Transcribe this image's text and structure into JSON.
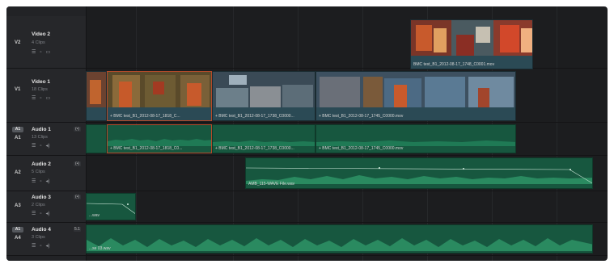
{
  "tracks": [
    {
      "id": "V2",
      "name": "Video 2",
      "clips": "4 Clips"
    },
    {
      "id": "V1",
      "name": "Video 1",
      "clips": "18 Clips"
    },
    {
      "id": "A1",
      "name": "Audio 1",
      "clips": "13 Clips",
      "chip": "A1",
      "mode": "(•)"
    },
    {
      "id": "A2",
      "name": "Audio 2",
      "clips": "5 Clips",
      "mode": "(•)"
    },
    {
      "id": "A3",
      "name": "Audio 3",
      "clips": "2 Clips",
      "mode": "(•)"
    },
    {
      "id": "A4",
      "name": "Audio 4",
      "clips": "3 Clips",
      "chip": "A1",
      "mode": "5.1"
    }
  ],
  "icons": {
    "video": [
      "toggle-icon",
      "lock-icon",
      "monitor-icon"
    ],
    "audio": [
      "toggle-icon",
      "lock-icon",
      "speaker-icon"
    ]
  },
  "clips": {
    "v2_clip": "BMC test_B1_2012-08-17_1748_C0001.mov",
    "v1_clip_a": "+ BMC test_B1_2012-08-17_1818_C...",
    "v1_clip_b": "+ BMC test_B1_2012-08-17_1738_C0000...",
    "v1_clip_c": "+ BMC test_B1_2012-08-17_1745_C0000.mov",
    "a1_clip_a": "+ BMC test_B1_2012-08-17_1818_C0...",
    "a1_clip_b": "+ BMC test_B1_2012-08-17_1738_C0000...",
    "a1_clip_c": "+ BMC test_B1_2012-08-17_1745_C0000.mov",
    "a2_clip": "AMB_115-WAVE File.wav",
    "a3_clip": "...wav",
    "a4_clip": "...se 03.wav"
  },
  "colors": {
    "video_clip": "#2b4a55",
    "audio_clip": "#17573f",
    "selection": "#b54a2a",
    "background": "#1c1d1f"
  }
}
